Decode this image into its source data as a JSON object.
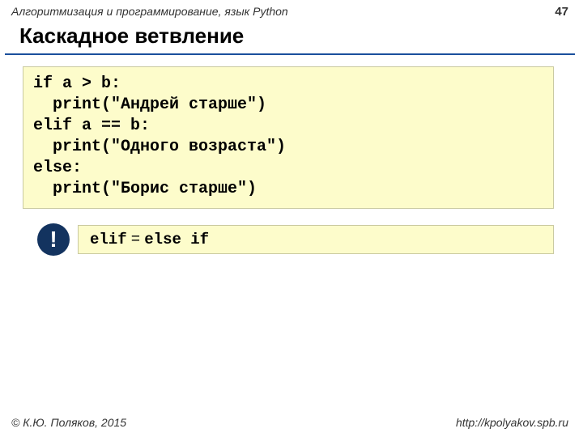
{
  "header": {
    "course": "Алгоритмизация и программирование, язык Python",
    "page": "47"
  },
  "title": "Каскадное ветвление",
  "code": {
    "l1": "if a > b:",
    "l2": "  print(\"Андрей старше\")",
    "l3": "elif a == b:",
    "l4": "  print(\"Одного возраста\")",
    "l5": "else:",
    "l6": "  print(\"Борис старше\")"
  },
  "note": {
    "bang": "!",
    "elif": "elif",
    "eq": " = ",
    "else_if": "else if"
  },
  "footer": {
    "copyright": "© К.Ю. Поляков, 2015",
    "url": "http://kpolyakov.spb.ru"
  }
}
